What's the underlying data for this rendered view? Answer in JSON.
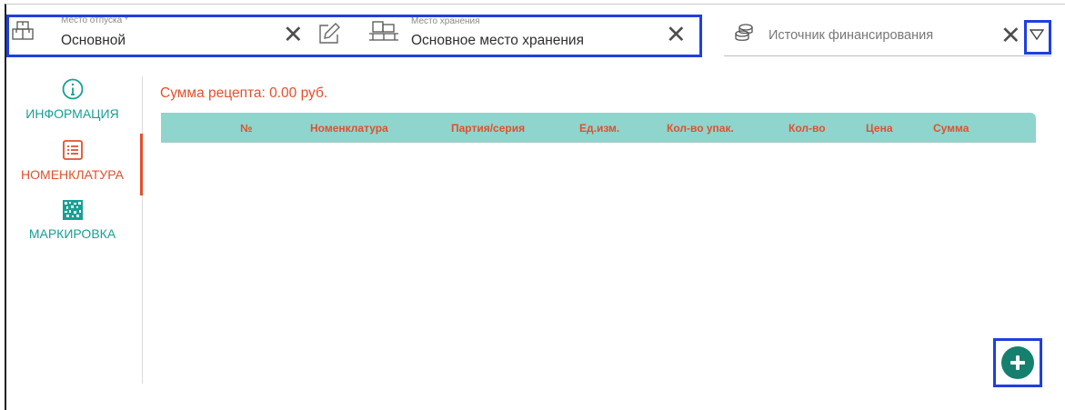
{
  "colors": {
    "accent": "#e2502c",
    "teal": "#17a094",
    "table_header_bg": "#8fd5cd",
    "highlight": "#1f3fe0",
    "add_button": "#16806f"
  },
  "fields": {
    "release_place": {
      "label": "Место отпуска *",
      "value": "Основной",
      "icon": "warehouse-icon"
    },
    "storage_place": {
      "label": "Место хранения",
      "value": "Основное место хранения",
      "icon": "storage-icon"
    },
    "funding_source": {
      "placeholder": "Источник финансирования",
      "icon": "coins-icon"
    }
  },
  "sidebar": {
    "items": [
      {
        "label": "ИНФОРМАЦИЯ",
        "icon": "info-icon",
        "active": false
      },
      {
        "label": "НОМЕНКЛАТУРА",
        "icon": "list-icon",
        "active": true
      },
      {
        "label": "МАРКИРОВКА",
        "icon": "datamatrix-icon",
        "active": false
      }
    ]
  },
  "main": {
    "sum_text": "Сумма рецепта: 0.00 руб.",
    "table": {
      "columns": [
        "№",
        "Номенклатура",
        "Партия/серия",
        "Ед.изм.",
        "Кол-во упак.",
        "Кол-во",
        "Цена",
        "Сумма"
      ],
      "rows": []
    }
  }
}
